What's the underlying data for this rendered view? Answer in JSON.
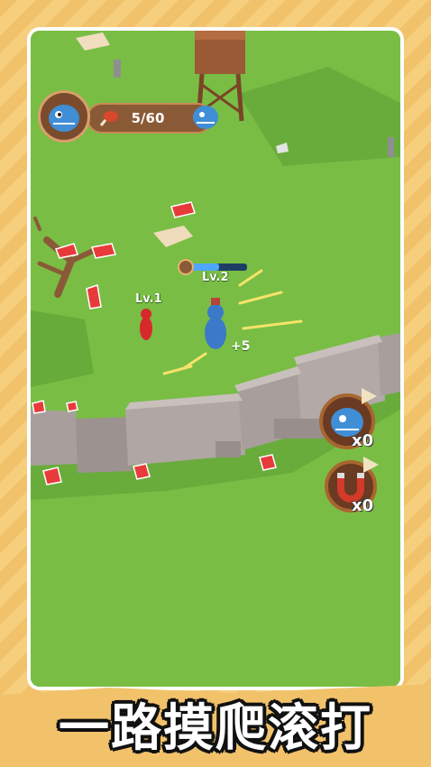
{
  "hud": {
    "meat_count": "5/60",
    "meat_icon": "meat-icon",
    "avatar_icon": "blue-dinosaur-icon"
  },
  "player": {
    "level_label": "Lv.2",
    "xp_fraction": 0.5,
    "gain_label": "+5"
  },
  "enemy": {
    "level_label": "Lv.1"
  },
  "powerups": [
    {
      "name": "dinosaur-powerup",
      "count_label": "x0",
      "icon": "dinosaur-icon"
    },
    {
      "name": "magnet-powerup",
      "count_label": "x0",
      "icon": "magnet-icon"
    }
  ],
  "banner": {
    "text": "一路摸爬滚打"
  },
  "colors": {
    "grass": "#79bd45",
    "wall": "#a79c9c",
    "meat": "#e83a3a",
    "banner_stripe": "#f2c26b"
  }
}
